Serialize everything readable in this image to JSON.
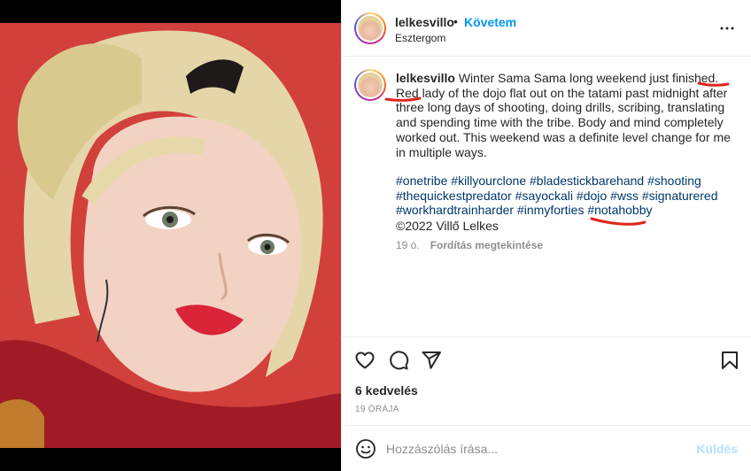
{
  "post": {
    "username": "lelkesvillo",
    "follow_label": "Követem",
    "location": "Esztergom"
  },
  "caption": {
    "username": "lelkesvillo",
    "text_before": " Winter Sama Sama long weekend just finished. ",
    "text_highlight": "Red lady",
    "text_after": " of the dojo flat out on the tatami past midnight after three long days of shooting, doing drills, scribing, translating and spending time with the tribe. Body and mind completely worked out. This weekend was a definite level change for me in multiple ways.",
    "hashtags": [
      "#onetribe",
      "#killyourclone",
      "#bladestickbarehand",
      "#shooting",
      "#thequickestpredator",
      "#sayockali",
      "#dojo",
      "#wss",
      "#signaturered",
      "#workhardtrainharder",
      "#inmyforties",
      "#notahobby"
    ],
    "copyright": "©2022 Villő Lelkes",
    "age": "19 ó.",
    "translate_label": "Fordítás megtekintése"
  },
  "stats": {
    "likes": "6 kedvelés",
    "timestamp": "19 ÓRÁJA"
  },
  "composer": {
    "placeholder": "Hozzászólás írása...",
    "send_label": "Küldés"
  },
  "colors": {
    "accent": "#0095f6",
    "hashtag": "#00376b",
    "annotation": "#e0241b",
    "send_disabled": "#b2dffc"
  },
  "icons": [
    "more-options-icon",
    "heart-icon",
    "comment-icon",
    "share-icon",
    "bookmark-icon",
    "emoji-icon"
  ]
}
